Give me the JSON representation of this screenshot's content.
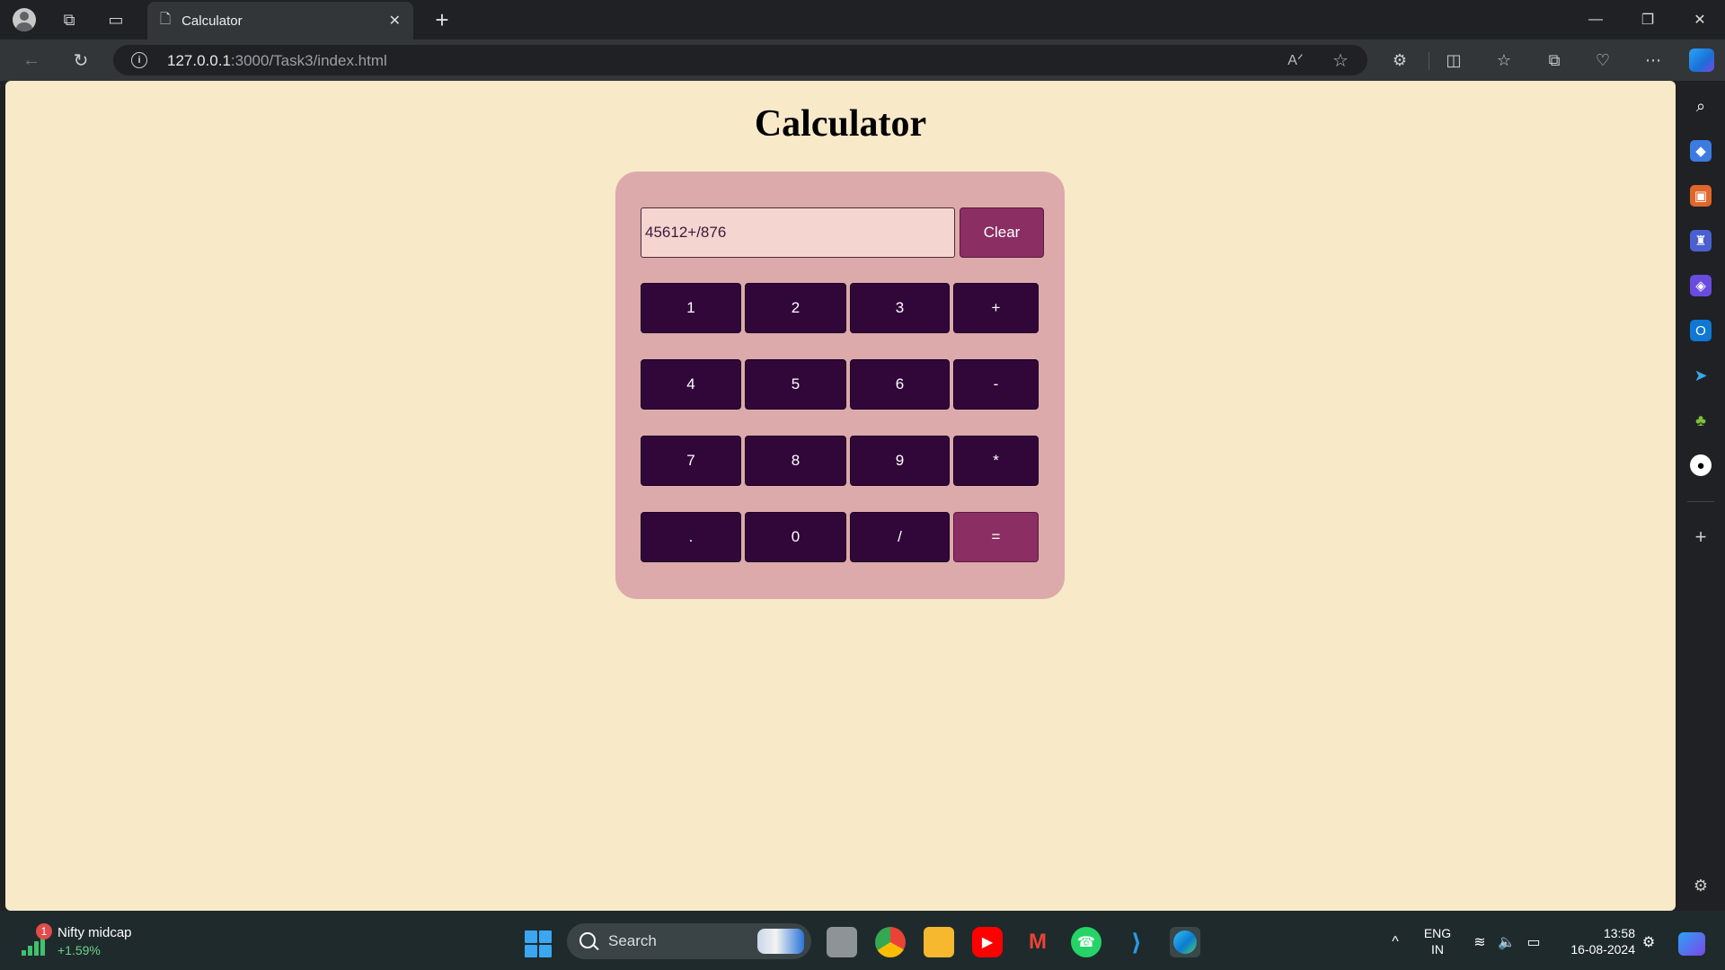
{
  "browser": {
    "tab_title": "Calculator",
    "url_host": "127.0.0.1",
    "url_rest": ":3000/Task3/index.html"
  },
  "page": {
    "title": "Calculator",
    "display_value": "45612+/876",
    "clear_label": "Clear",
    "keys": [
      {
        "label": "1"
      },
      {
        "label": "2"
      },
      {
        "label": "3"
      },
      {
        "label": "+"
      },
      {
        "label": "4"
      },
      {
        "label": "5"
      },
      {
        "label": "6"
      },
      {
        "label": "-"
      },
      {
        "label": "7"
      },
      {
        "label": "8"
      },
      {
        "label": "9"
      },
      {
        "label": "*"
      },
      {
        "label": "."
      },
      {
        "label": "0"
      },
      {
        "label": "/"
      },
      {
        "label": "="
      }
    ]
  },
  "taskbar": {
    "widget_badge": "1",
    "widget_name": "Nifty midcap",
    "widget_value": "+1.59%",
    "search_label": "Search",
    "lang_primary": "ENG",
    "lang_secondary": "IN",
    "time": "13:58",
    "date": "16-08-2024"
  },
  "colors": {
    "page_bg": "#f8e9c9",
    "calc_bg": "#dcaaab",
    "key_bg": "#31073a",
    "accent": "#8a2e63",
    "display_bg": "#f5d5d0"
  }
}
